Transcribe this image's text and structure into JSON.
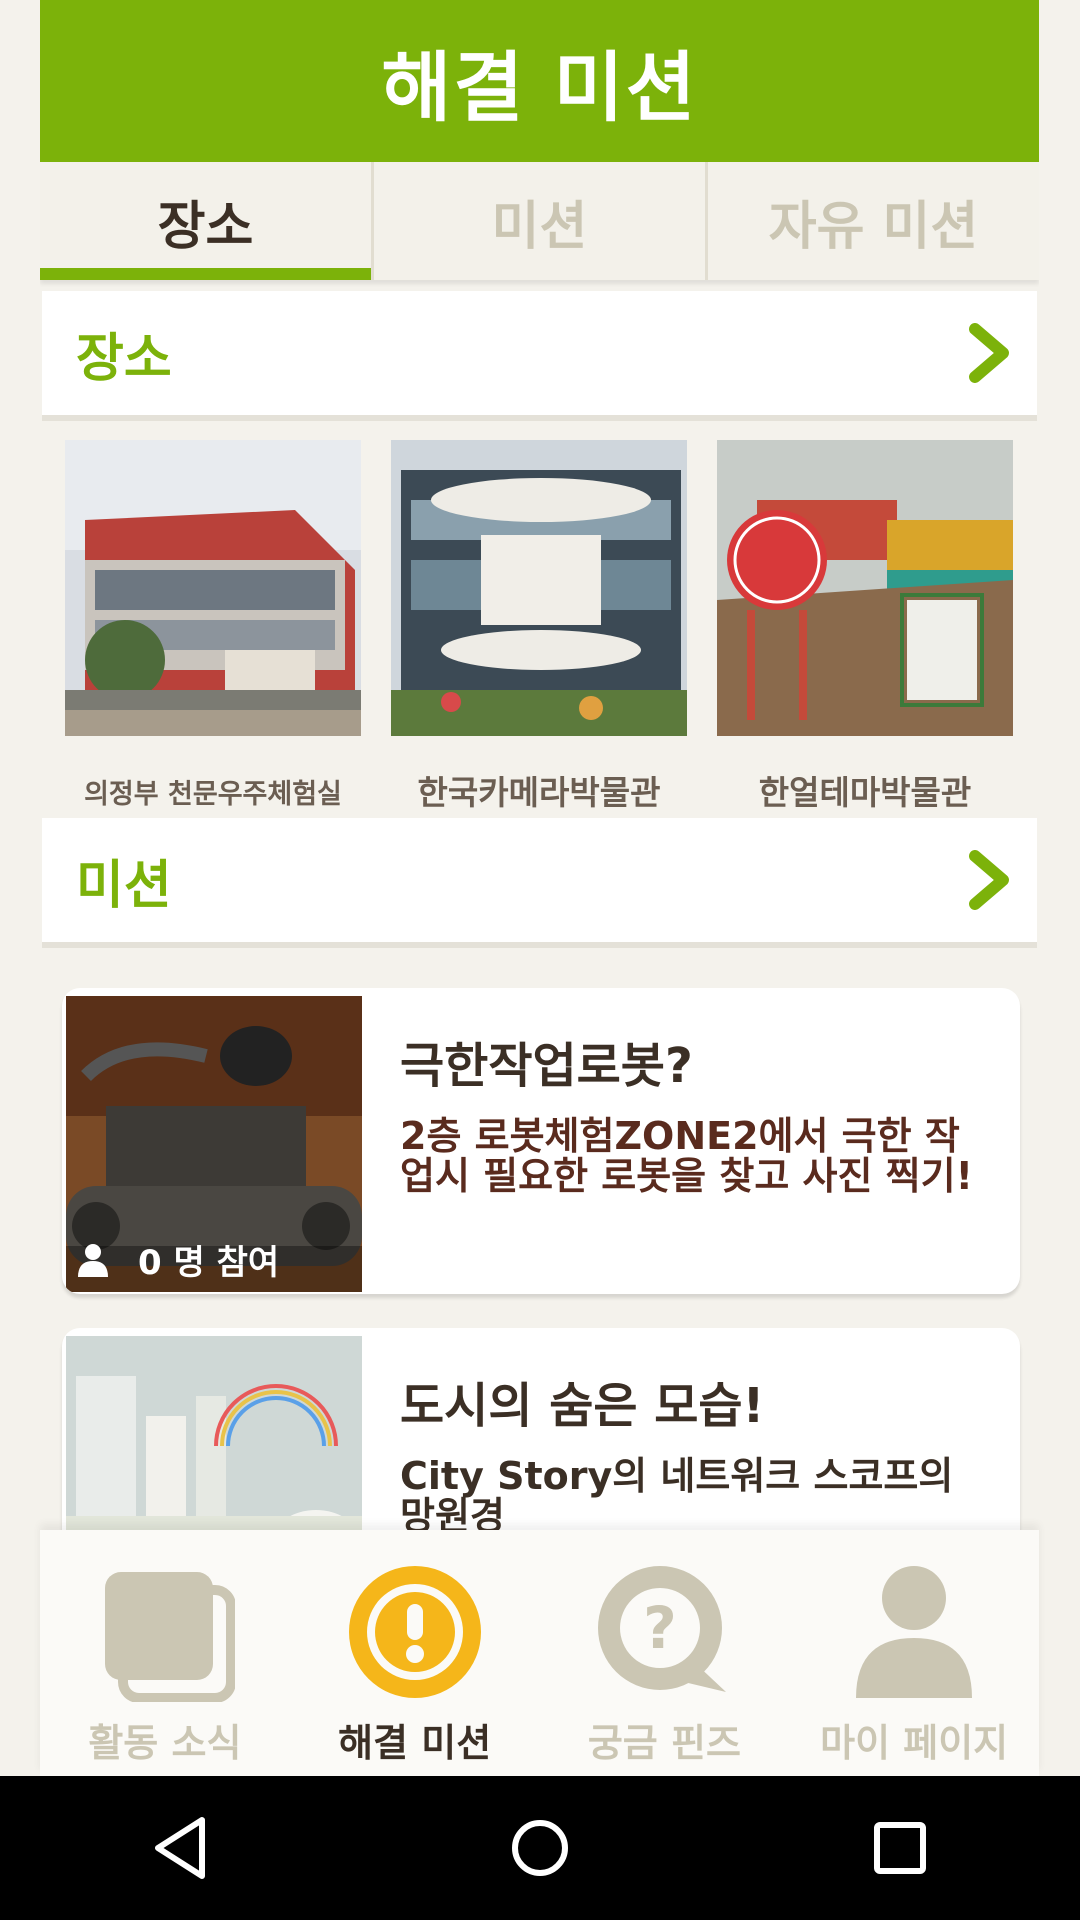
{
  "header": {
    "title": "해결 미션"
  },
  "tabs": [
    {
      "label": "장소",
      "active": true
    },
    {
      "label": "미션",
      "active": false
    },
    {
      "label": "자유 미션",
      "active": false
    }
  ],
  "places_section": {
    "title": "장소"
  },
  "places": [
    {
      "name": "의정부 천문우주체험실"
    },
    {
      "name": "한국카메라박물관"
    },
    {
      "name": "한얼테마박물관"
    }
  ],
  "missions_section": {
    "title": "미션"
  },
  "missions": [
    {
      "title": "극한작업로봇?",
      "description": "2층 로봇체험ZONE2에서 극한 작업시 필요한 로봇을 찾고 사진 찍기!",
      "participants": "0 명 참여"
    },
    {
      "title": "도시의 숨은 모습!",
      "description": "City Story의 네트워크 스코프의 망원경"
    }
  ],
  "bottom_nav": [
    {
      "label": "활동 소식",
      "icon": "news-icon",
      "active": false
    },
    {
      "label": "해결 미션",
      "icon": "mission-alert-icon",
      "active": true
    },
    {
      "label": "궁금 핀즈",
      "icon": "question-bubble-icon",
      "active": false
    },
    {
      "label": "마이 페이지",
      "icon": "person-icon",
      "active": false
    }
  ],
  "system_bar": {
    "back": "back-icon",
    "home": "home-icon",
    "recents": "recents-icon"
  },
  "colors": {
    "accent": "#7cb20a",
    "active_icon": "#f5b61a",
    "inactive": "#cbc6b3",
    "text_dark": "#3b2f25"
  }
}
